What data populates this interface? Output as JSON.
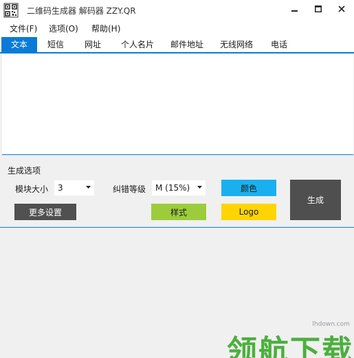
{
  "window": {
    "title": "二维码生成器 解码器 ZZY.QR",
    "icon": "qr-code-icon"
  },
  "menu": {
    "items": [
      "文件(F)",
      "选项(O)",
      "帮助(H)"
    ]
  },
  "tabs": {
    "items": [
      "文本",
      "短信",
      "网址",
      "个人名片",
      "邮件地址",
      "无线网络",
      "电话"
    ],
    "active": 0
  },
  "input": {
    "value": ""
  },
  "options": {
    "section_title": "生成选项",
    "module_size_label": "模块大小",
    "module_size_value": "3",
    "error_level_label": "纠错等级",
    "error_level_value": "M (15%)",
    "more_settings_label": "更多设置",
    "color_label": "颜色",
    "style_label": "样式",
    "logo_label": "Logo",
    "generate_label": "生成"
  },
  "watermark": {
    "text": "领航下载",
    "url": "lhdown.com"
  },
  "colors": {
    "accent": "#0a7bd8",
    "color_button": "#1ab0ef",
    "style_button": "#9ccc3c",
    "logo_button": "#ffd400",
    "dark_button": "#4f4f4f",
    "watermark": "#4ab03c"
  }
}
